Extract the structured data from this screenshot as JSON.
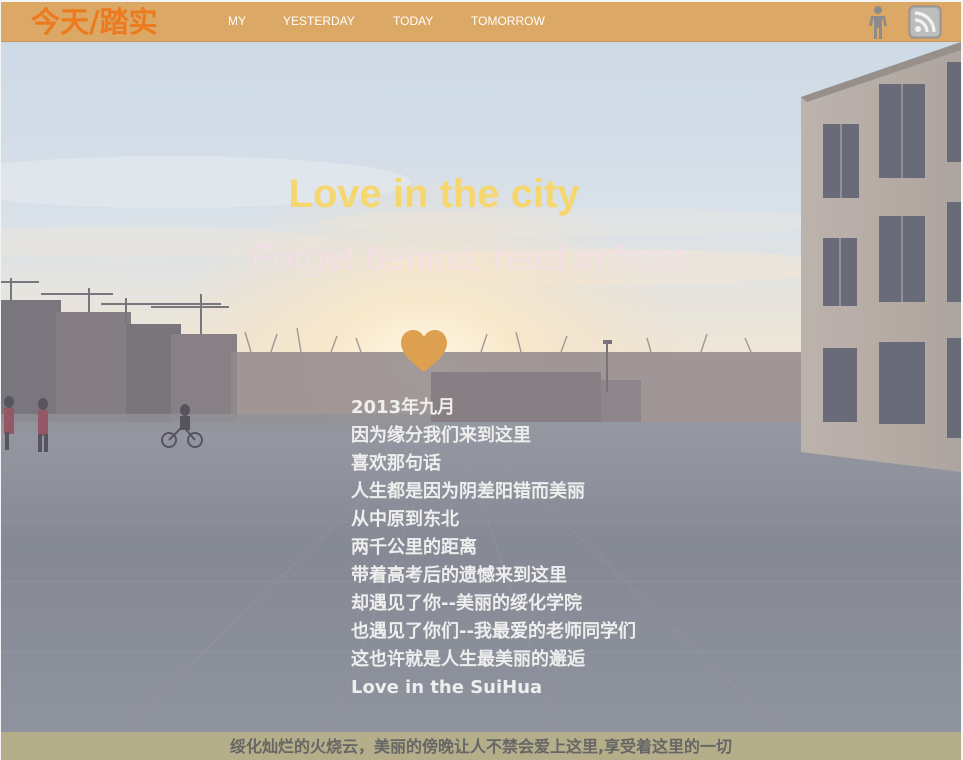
{
  "header": {
    "logo_text": "今天/踏实",
    "nav": [
      {
        "label": "MY"
      },
      {
        "label": "YESTERDAY"
      },
      {
        "label": "TODAY"
      },
      {
        "label": "TOMORROW"
      }
    ],
    "icons": [
      "person-icon",
      "rss-icon"
    ]
  },
  "hero": {
    "title": "Love in the city",
    "subtitle": "Forget behind, hard in front",
    "heart_icon": "heart-icon",
    "poem": [
      "2013年九月",
      "因为缘分我们来到这里",
      "喜欢那句话",
      "人生都是因为阴差阳错而美丽",
      "从中原到东北",
      "两千公里的距离",
      "带着高考后的遗憾来到这里",
      "却遇见了你--美丽的绥化学院",
      "也遇见了你们--我最爱的老师同学们",
      "这也许就是人生最美丽的邂逅",
      "Love in the SuiHua"
    ]
  },
  "footer": {
    "text": "绥化灿烂的火烧云，美丽的傍晚让人不禁会爱上这里,享受着这里的一切"
  },
  "colors": {
    "nav_bar": "#dca865",
    "logo": "#ec7a1e",
    "title": "#f5d76e",
    "heart": "#dca050",
    "footer_bar": "#b5ae8a",
    "footer_text": "#666666"
  }
}
